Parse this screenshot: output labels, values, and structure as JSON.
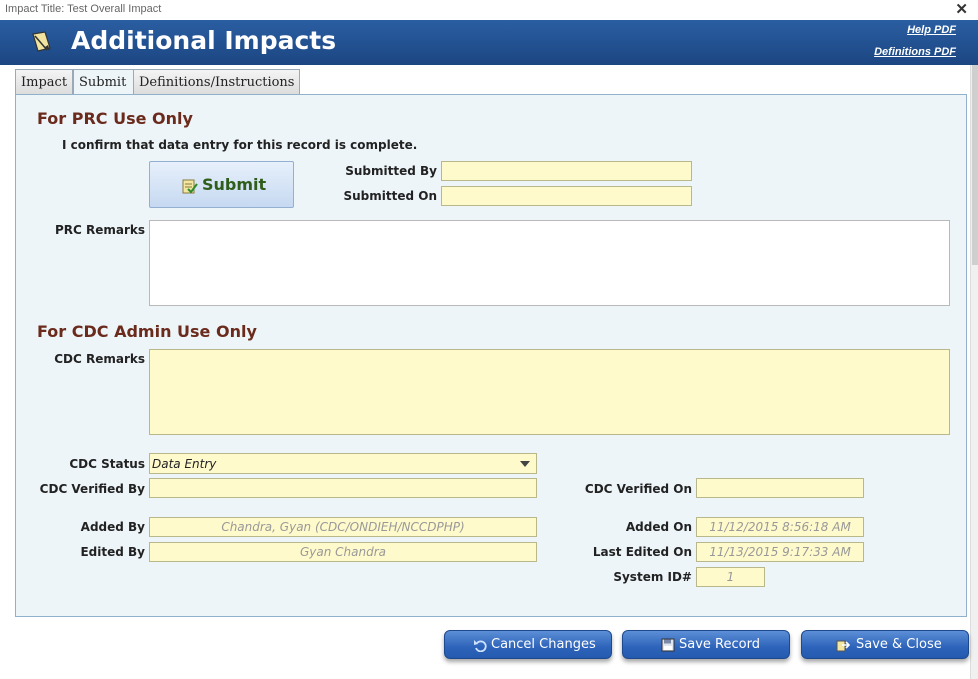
{
  "window": {
    "title": "Impact Title: Test Overall Impact",
    "close_glyph": "✕"
  },
  "header": {
    "title": "Additional Impacts",
    "help_link": "Help PDF",
    "definitions_link": "Definitions PDF",
    "logo_icon": "note-pencil-icon"
  },
  "tabs": [
    {
      "label": "Impact"
    },
    {
      "label": "Submit",
      "active": true
    },
    {
      "label": "Definitions/Instructions"
    }
  ],
  "prc": {
    "section_title": "For PRC Use Only",
    "confirm_text": "I confirm that data entry for this record is complete.",
    "submit_label": "Submit",
    "submitted_by_label": "Submitted By",
    "submitted_by_value": "",
    "submitted_on_label": "Submitted On",
    "submitted_on_value": "",
    "remarks_label": "PRC Remarks",
    "remarks_value": ""
  },
  "cdc": {
    "section_title": "For CDC Admin Use Only",
    "remarks_label": "CDC Remarks",
    "remarks_value": "",
    "status_label": "CDC Status",
    "status_value": "Data Entry",
    "verified_by_label": "CDC Verified By",
    "verified_by_value": "",
    "verified_on_label": "CDC Verified On",
    "verified_on_value": "",
    "added_by_label": "Added By",
    "added_by_value": "Chandra, Gyan (CDC/ONDIEH/NCCDPHP)",
    "edited_by_label": "Edited By",
    "edited_by_value": "Gyan Chandra",
    "added_on_label": "Added On",
    "added_on_value": "11/12/2015 8:56:18 AM",
    "last_edited_on_label": "Last Edited On",
    "last_edited_on_value": "11/13/2015 9:17:33 AM",
    "system_id_label": "System ID#",
    "system_id_value": "1"
  },
  "actions": {
    "cancel_label": "Cancel Changes",
    "save_label": "Save Record",
    "save_close_label": "Save & Close"
  },
  "colors": {
    "header_blue": "#1f4e8c",
    "section_title": "#6a2a1c",
    "field_yellow": "#fffacc",
    "panel_bg": "#eef5f9"
  }
}
